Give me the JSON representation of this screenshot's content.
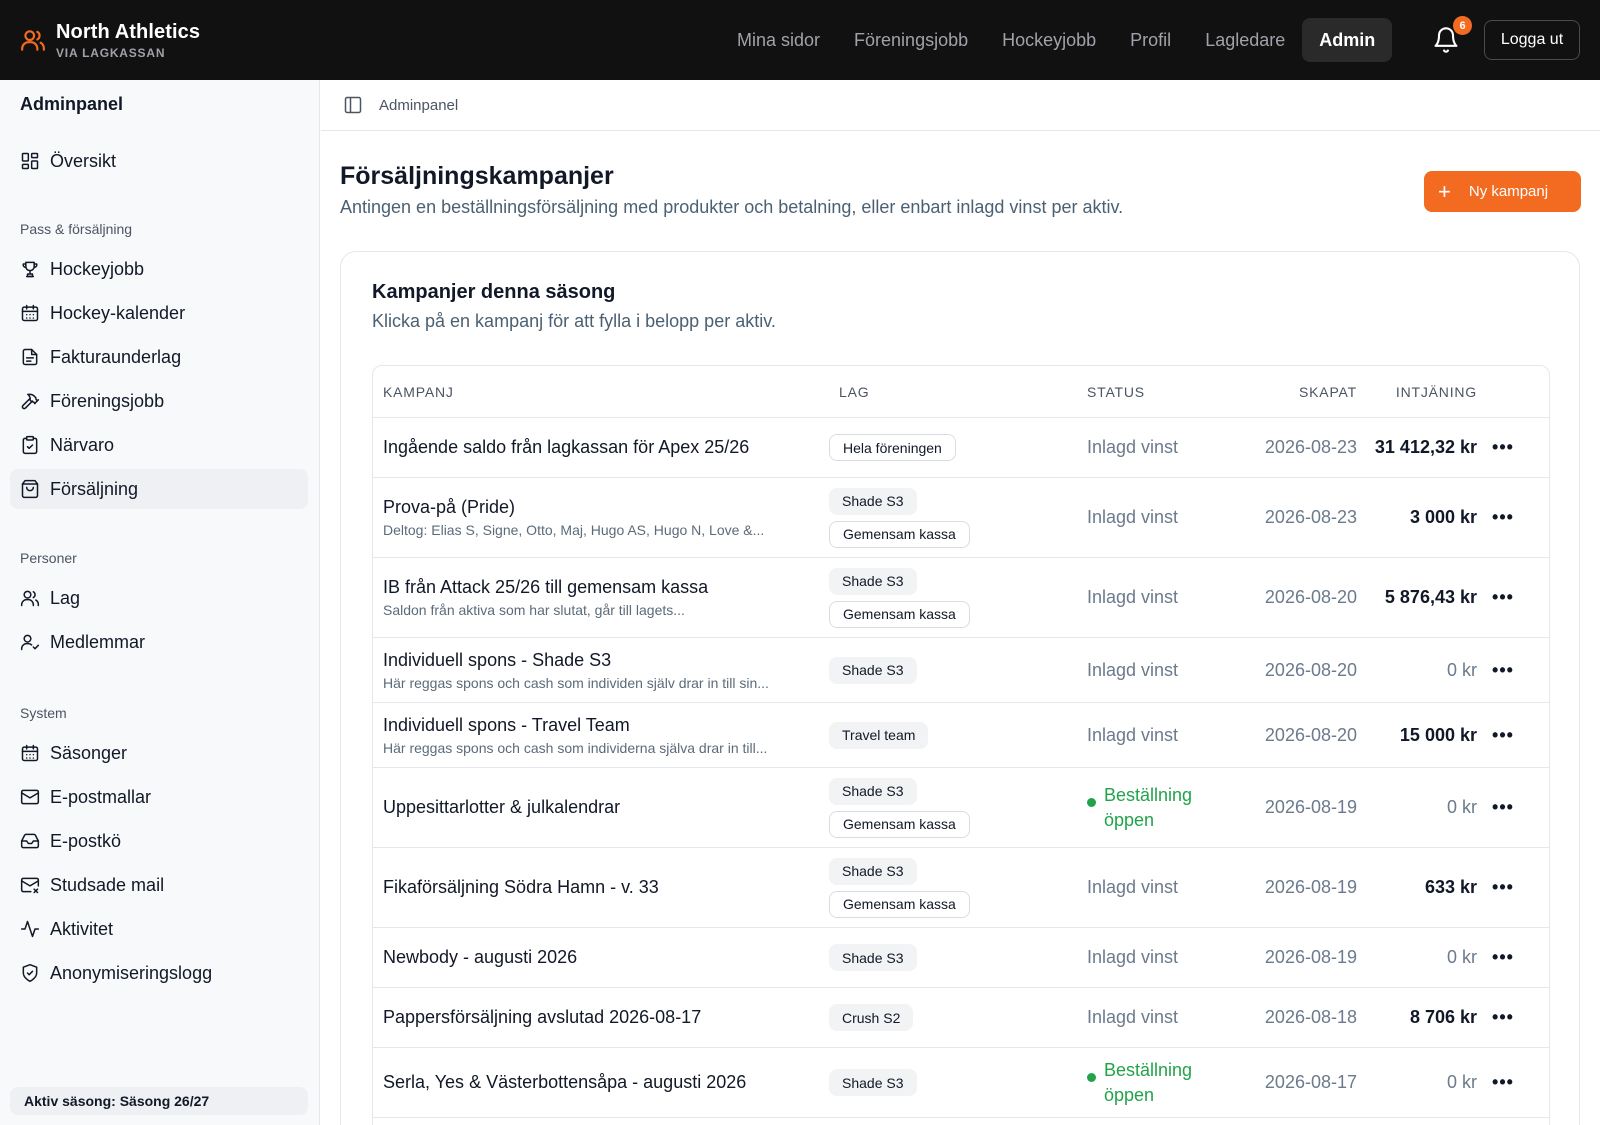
{
  "brand": {
    "name": "North Athletics",
    "sub": "VIA LAGKASSAN",
    "icon": "users-icon"
  },
  "topnav": [
    {
      "label": "Mina sidor",
      "active": false
    },
    {
      "label": "Föreningsjobb",
      "active": false
    },
    {
      "label": "Hockeyjobb",
      "active": false
    },
    {
      "label": "Profil",
      "active": false
    },
    {
      "label": "Lagledare",
      "active": false
    },
    {
      "label": "Admin",
      "active": true
    }
  ],
  "notifications": {
    "count": "6"
  },
  "logout_label": "Logga ut",
  "sidebar": {
    "title": "Adminpanel",
    "overview": "Översikt",
    "sections": {
      "sales": "Pass & försäljning",
      "people": "Personer",
      "system": "System"
    },
    "sales_items": [
      "Hockeyjobb",
      "Hockey-kalender",
      "Fakturaunderlag",
      "Föreningsjobb",
      "Närvaro",
      "Försäljning"
    ],
    "people_items": [
      "Lag",
      "Medlemmar"
    ],
    "system_items": [
      "Säsonger",
      "E-postmallar",
      "E-postkö",
      "Studsade mail",
      "Aktivitet",
      "Anonymiseringslogg"
    ],
    "active_item": "Försäljning",
    "season": "Aktiv säsong: Säsong 26/27"
  },
  "breadcrumb": "Adminpanel",
  "page": {
    "title": "Försäljningskampanjer",
    "subtitle": "Antingen en beställningsförsäljning med produkter och betalning, eller enbart inlagd vinst per aktiv.",
    "new_button": "Ny kampanj"
  },
  "card": {
    "title": "Kampanjer denna säsong",
    "subtitle": "Klicka på en kampanj för att fylla i belopp per aktiv."
  },
  "table": {
    "headers": {
      "campaign": "KAMPANJ",
      "team": "LAG",
      "status": "STATUS",
      "created": "SKAPAT",
      "earnings": "INTJÄNING"
    },
    "rows": [
      {
        "name": "Ingående saldo från lagkassan för Apex 25/26",
        "desc": "",
        "tags": [
          {
            "label": "Hela föreningen",
            "style": "outline"
          }
        ],
        "status": "Inlagd vinst",
        "open": false,
        "created": "2026-08-23",
        "amount": "31 412,32 kr",
        "bold": true
      },
      {
        "name": "Prova-på (Pride)",
        "desc": "Deltog: Elias S, Signe, Otto, Maj, Hugo AS, Hugo N, Love &...",
        "tags": [
          {
            "label": "Shade S3",
            "style": "grey"
          },
          {
            "label": "Gemensam kassa",
            "style": "outline"
          }
        ],
        "status": "Inlagd vinst",
        "open": false,
        "created": "2026-08-23",
        "amount": "3 000 kr",
        "bold": true
      },
      {
        "name": "IB från Attack 25/26 till gemensam kassa",
        "desc": "Saldon från aktiva som har slutat, går till lagets...",
        "tags": [
          {
            "label": "Shade S3",
            "style": "grey"
          },
          {
            "label": "Gemensam kassa",
            "style": "outline"
          }
        ],
        "status": "Inlagd vinst",
        "open": false,
        "created": "2026-08-20",
        "amount": "5 876,43 kr",
        "bold": true
      },
      {
        "name": "Individuell spons - Shade S3",
        "desc": "Här reggas spons och cash som individen själv drar in till sin...",
        "tags": [
          {
            "label": "Shade S3",
            "style": "grey"
          }
        ],
        "status": "Inlagd vinst",
        "open": false,
        "created": "2026-08-20",
        "amount": "0 kr",
        "bold": false
      },
      {
        "name": "Individuell spons - Travel Team",
        "desc": "Här reggas spons och cash som individerna själva drar in till...",
        "tags": [
          {
            "label": "Travel team",
            "style": "grey"
          }
        ],
        "status": "Inlagd vinst",
        "open": false,
        "created": "2026-08-20",
        "amount": "15 000 kr",
        "bold": true
      },
      {
        "name": "Uppesittarlotter & julkalendrar",
        "desc": "",
        "tags": [
          {
            "label": "Shade S3",
            "style": "grey"
          },
          {
            "label": "Gemensam kassa",
            "style": "outline"
          }
        ],
        "status": "Beställning öppen",
        "open": true,
        "created": "2026-08-19",
        "amount": "0 kr",
        "bold": false
      },
      {
        "name": "Fikaförsäljning Södra Hamn - v. 33",
        "desc": "",
        "tags": [
          {
            "label": "Shade S3",
            "style": "grey"
          },
          {
            "label": "Gemensam kassa",
            "style": "outline"
          }
        ],
        "status": "Inlagd vinst",
        "open": false,
        "created": "2026-08-19",
        "amount": "633 kr",
        "bold": true
      },
      {
        "name": "Newbody - augusti 2026",
        "desc": "",
        "tags": [
          {
            "label": "Shade S3",
            "style": "grey"
          }
        ],
        "status": "Inlagd vinst",
        "open": false,
        "created": "2026-08-19",
        "amount": "0 kr",
        "bold": false
      },
      {
        "name": "Pappersförsäljning avslutad 2026-08-17",
        "desc": "",
        "tags": [
          {
            "label": "Crush S2",
            "style": "grey"
          }
        ],
        "status": "Inlagd vinst",
        "open": false,
        "created": "2026-08-18",
        "amount": "8 706 kr",
        "bold": true
      },
      {
        "name": "Serla, Yes & Västerbottensåpa - augusti 2026",
        "desc": "",
        "tags": [
          {
            "label": "Shade S3",
            "style": "grey"
          }
        ],
        "status": "Beställning öppen",
        "open": true,
        "created": "2026-08-17",
        "amount": "0 kr",
        "bold": false
      }
    ],
    "more_label": "•••"
  },
  "colors": {
    "accent": "#f26b21",
    "topbar": "#111111",
    "open_status": "#22a34a"
  }
}
